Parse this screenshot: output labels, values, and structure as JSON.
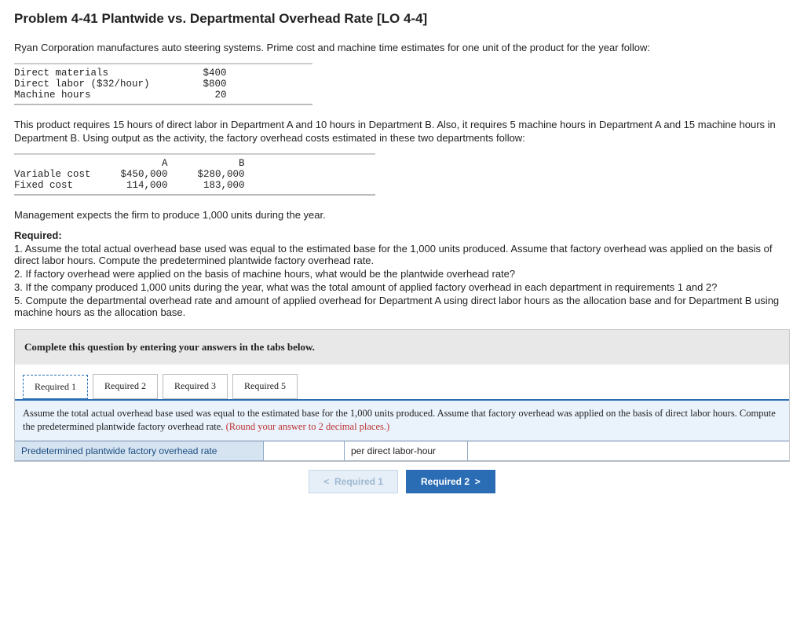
{
  "title": "Problem 4-41 Plantwide vs. Departmental Overhead Rate [LO 4-4]",
  "intro": "Ryan Corporation manufactures auto steering systems. Prime cost and machine time estimates for one unit of the product for the year follow:",
  "unit_costs": {
    "rows": [
      {
        "label": "Direct materials",
        "value": "$400"
      },
      {
        "label": "Direct labor ($32/hour)",
        "value": "$800"
      },
      {
        "label": "Machine hours",
        "value": "20"
      }
    ]
  },
  "mid_para": "This product requires 15 hours of direct labor in Department A and 10 hours in Department B. Also, it requires 5 machine hours in Department A and 15 machine hours in Department B. Using output as the activity, the factory overhead costs estimated in these two departments follow:",
  "dept_costs": {
    "cols": [
      "A",
      "B"
    ],
    "rows": [
      {
        "label": "Variable cost",
        "a": "$450,000",
        "b": "$280,000"
      },
      {
        "label": "Fixed cost",
        "a": "114,000",
        "b": "183,000"
      }
    ]
  },
  "expect_line": "Management expects the firm to produce 1,000 units during the year.",
  "required_label": "Required:",
  "requirements": [
    "1. Assume the total actual overhead base used was equal to the estimated base for the 1,000 units produced. Assume that factory overhead was applied on the basis of direct labor hours. Compute the predetermined plantwide factory overhead rate.",
    "2. If factory overhead were applied on the basis of machine hours, what would be the plantwide overhead rate?",
    "3. If the company produced 1,000 units during the year, what was the total amount of applied factory overhead in each department in requirements 1 and 2?",
    "5. Compute the departmental overhead rate and amount of applied overhead for Department A using direct labor hours as the allocation base and for Department B using machine hours as the allocation base."
  ],
  "answer": {
    "instruction": "Complete this question by entering your answers in the tabs below.",
    "tabs": [
      {
        "label": "Required 1",
        "active": true
      },
      {
        "label": "Required 2",
        "active": false
      },
      {
        "label": "Required 3",
        "active": false
      },
      {
        "label": "Required 5",
        "active": false
      }
    ],
    "prompt_main": "Assume the total actual overhead base used was equal to the estimated base for the 1,000 units produced. Assume that factory overhead was applied on the basis of direct labor hours. Compute the predetermined plantwide factory overhead rate. ",
    "prompt_round": "(Round your answer to 2 decimal places.)",
    "row_label": "Predetermined plantwide factory overhead rate",
    "row_unit": "per direct labor-hour",
    "nav_prev": "Required 1",
    "nav_next": "Required 2"
  }
}
